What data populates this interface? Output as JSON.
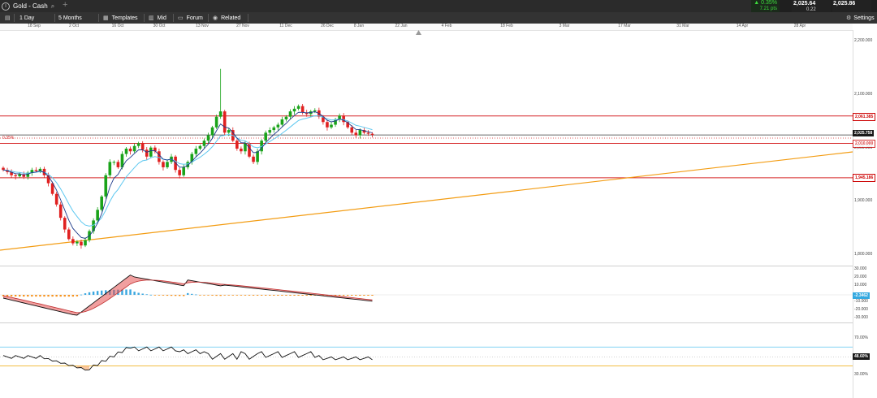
{
  "instrument": {
    "title": "Gold - Cash"
  },
  "toolbar": {
    "interval": "1 Day",
    "range": "5 Months",
    "templates": "Templates",
    "price_type": "Mid",
    "forum": "Forum",
    "related": "Related",
    "settings": "Settings"
  },
  "quote": {
    "change_pct": "▲ 0.35%",
    "change_pts": "7.21 pts",
    "bid": "2,025.64",
    "spread": "0.22",
    "ask": "2,025.86"
  },
  "x_axis_labels": [
    "18 Sep",
    "2 Oct",
    "16 Oct",
    "30 Oct",
    "13 Nov",
    "27 Nov",
    "11 Dec",
    "26 Dec",
    "8 Jan",
    "22 Jan",
    "4 Feb",
    "18 Feb",
    "3 Mar",
    "17 Mar",
    "31 Mar",
    "14 Apr",
    "28 Apr"
  ],
  "price_axis": {
    "labels": [
      "2,200.000",
      "2,100.000",
      "2,000.000",
      "1,900.000",
      "1,800.000"
    ]
  },
  "price_tags": {
    "resistance": "2,061.385",
    "current": "2,025.758",
    "hidden": "2,010.000",
    "support": "1,945.186",
    "change_marker": "0.35%"
  },
  "macd_axis": {
    "labels": [
      "30.000",
      "20.000",
      "10.000",
      "-10.000",
      "-20.000",
      "-30.000"
    ],
    "value": "-2.3462"
  },
  "rsi_axis": {
    "labels": [
      "70.00%",
      "30.00%"
    ],
    "value": "48.60%"
  },
  "colors": {
    "bull": "#1aa31a",
    "bear": "#e02020",
    "ma_fast": "#1e3a8a",
    "ma_slow": "#5ec8f0",
    "trend": "#f39c12",
    "hline": "#d62728",
    "toolbar_bg": "#2b2b2b",
    "quote_up": "#3ddc3d"
  },
  "chart_data": {
    "type": "candlestick",
    "x": [
      "18 Sep",
      "2 Oct",
      "16 Oct",
      "30 Oct",
      "13 Nov",
      "27 Nov",
      "11 Dec",
      "26 Dec",
      "8 Jan",
      "22 Jan"
    ],
    "close_approx": [
      1930,
      1825,
      1960,
      1990,
      1955,
      2055,
      1985,
      2060,
      2035,
      2026
    ],
    "ylim": [
      1780,
      2220
    ],
    "horizontal_lines": [
      2061.385,
      2025.758,
      2010.0,
      1945.186
    ],
    "trendline": {
      "from": [
        "18 Sep",
        1800
      ],
      "to": [
        "28 Apr",
        1995
      ]
    },
    "macd": {
      "ylim": [
        -30,
        30
      ],
      "last": -2.3462
    },
    "rsi": {
      "overbought": 70,
      "oversold": 30,
      "last": 48.6
    }
  }
}
